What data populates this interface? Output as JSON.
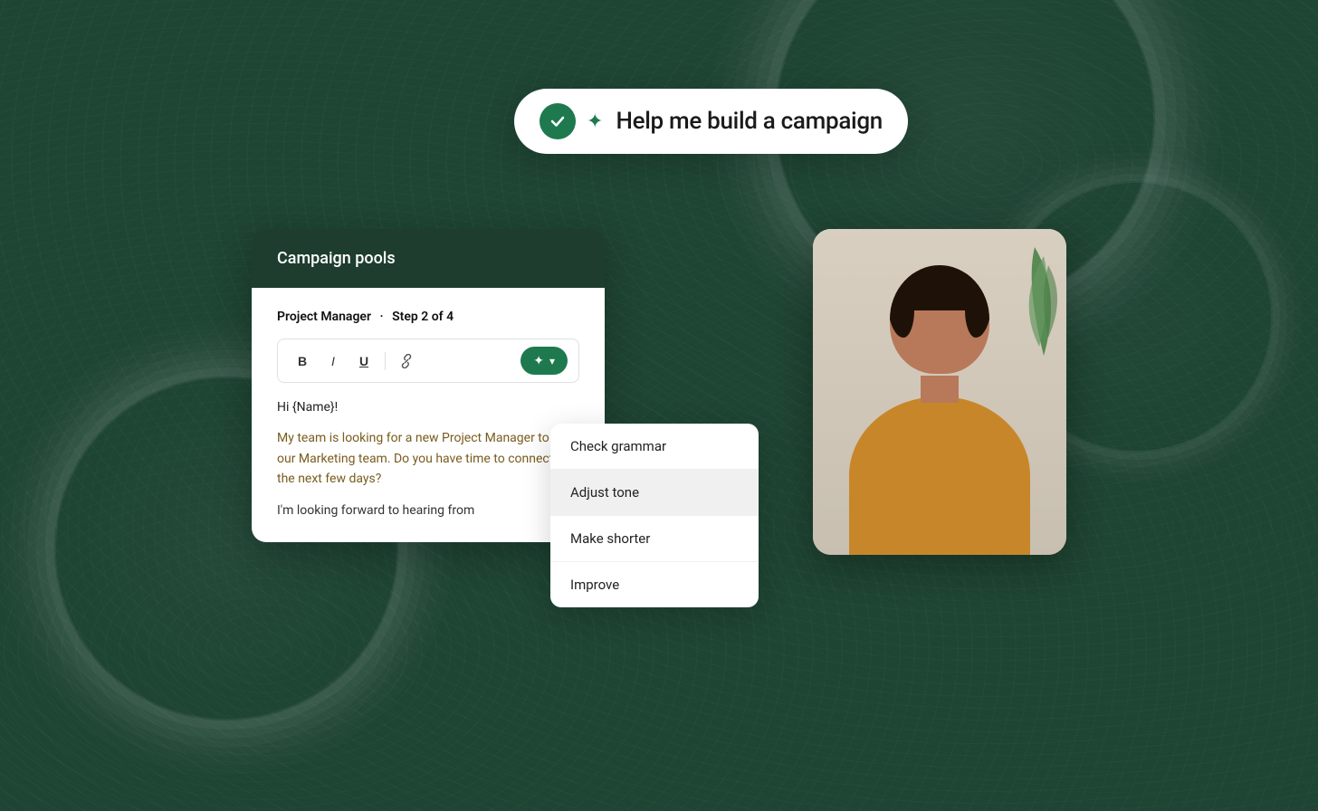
{
  "background": {
    "color": "#1e4433"
  },
  "campaign_pill": {
    "text": "Help me build a campaign",
    "check_icon": "check",
    "sparkle_icon": "✦"
  },
  "campaign_card": {
    "header": {
      "title": "Campaign pools"
    },
    "body": {
      "step_label": "Project Manager",
      "step_separator": "·",
      "step_info": "Step 2 of 4",
      "toolbar": {
        "bold_label": "B",
        "italic_label": "I",
        "underline_label": "U",
        "link_label": "🔗",
        "ai_button_label": "✦",
        "ai_chevron": "▾"
      },
      "email": {
        "greeting": "Hi {Name}!",
        "paragraph1": "My team is looking for a new Project Manager to join our Marketing team. Do you have time to connect in the next few days?",
        "paragraph2": "I'm looking forward to hearing from"
      }
    }
  },
  "dropdown": {
    "items": [
      {
        "label": "Check grammar",
        "active": false
      },
      {
        "label": "Adjust tone",
        "active": true
      },
      {
        "label": "Make shorter",
        "active": false
      },
      {
        "label": "Improve",
        "active": false
      }
    ]
  }
}
